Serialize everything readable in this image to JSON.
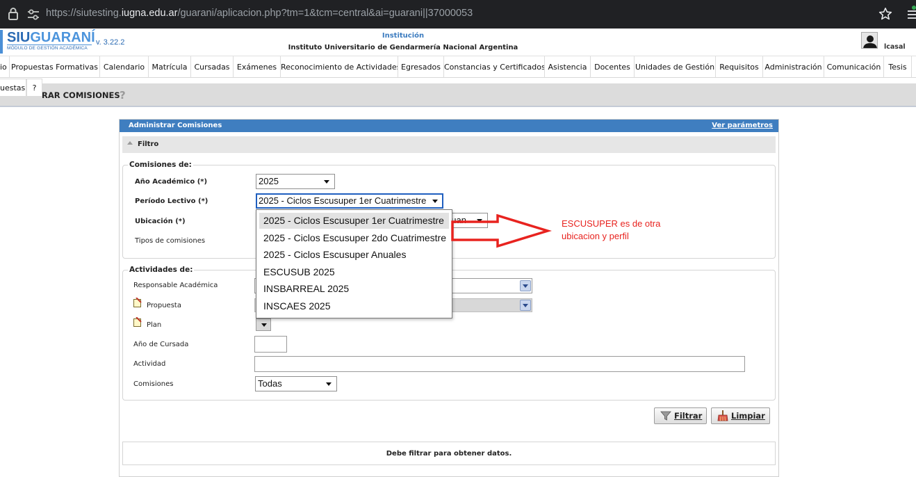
{
  "browser": {
    "url_prefix": "https://siutesting.",
    "url_domain": "iugna.edu.ar",
    "url_path": "/guarani/aplicacion.php?tm=1&tcm=central&ai=guarani||37000053"
  },
  "header": {
    "logo_siu": "SIU",
    "logo_guarani": "GUARANÍ",
    "logo_subtitle": "MÓDULO DE GESTIÓN ACADÉMICA",
    "version": "v. 3.22.2",
    "institution_label": "Institución",
    "institution_name": "Instituto Universitario de Gendarmería Nacional Argentina",
    "username": "lcasal"
  },
  "menu": {
    "items": [
      "io",
      "Propuestas Formativas",
      "Calendario",
      "Matrícula",
      "Cursadas",
      "Exámenes",
      "Reconocimiento de Actividades",
      "Egresados",
      "Constancias y Certificados",
      "Asistencia",
      "Docentes",
      "Unidades de Gestión",
      "Requisitos",
      "Administración",
      "Comunicación",
      "Tesis"
    ]
  },
  "submenu": {
    "items": [
      "uestas",
      "?"
    ]
  },
  "page": {
    "title": "RAR COMISIONES",
    "help": "?"
  },
  "panel": {
    "title": "Administrar Comisiones",
    "link": "Ver parámetros",
    "filter_label": "Filtro",
    "comisiones_legend": "Comisiones de:",
    "anio_label": "Año Académico (*)",
    "anio_value": "2025",
    "periodo_label": "Período Lectivo (*)",
    "periodo_value": "2025 - Ciclos Escusuper 1er Cuatrimestre",
    "ubicacion_label": "Ubicación (*)",
    "ubicacion_value_partial": "uan",
    "tipos_label": "Tipos de comisiones",
    "actividades_legend": "Actividades de:",
    "responsable_label": "Responsable Académica",
    "propuesta_label": "Propuesta",
    "plan_label": "Plan",
    "anio_cursada_label": "Año de Cursada",
    "actividad_label": "Actividad",
    "comisiones_label": "Comisiones",
    "comisiones_value": "Todas",
    "filtrar_button": "Filtrar",
    "limpiar_button": "Limpiar",
    "message": "Debe filtrar para obtener datos."
  },
  "dropdown": {
    "options": [
      "2025 - Ciclos Escusuper 1er Cuatrimestre",
      "2025 - Ciclos Escusuper 2do Cuatrimestre",
      "2025 - Ciclos Escusuper Anuales",
      "ESCUSUB 2025",
      "INSBARREAL 2025",
      "INSCAES 2025"
    ],
    "selected_index": 0
  },
  "annotation": {
    "line1": "ESCUSUPER es de otra",
    "line2": "ubicacion y perfil",
    "color": "#e8231f"
  },
  "colors": {
    "accent": "#3f7ec0",
    "brand": "#2a6ab3"
  },
  "icons": {
    "lock": "lock-icon",
    "tune": "site-settings-icon",
    "star": "bookmark-star-icon",
    "menu": "browser-menu-icon",
    "user": "user-avatar-icon",
    "filter": "funnel-icon",
    "broom": "broom-icon",
    "note": "note-icon",
    "help": "help-icon"
  }
}
